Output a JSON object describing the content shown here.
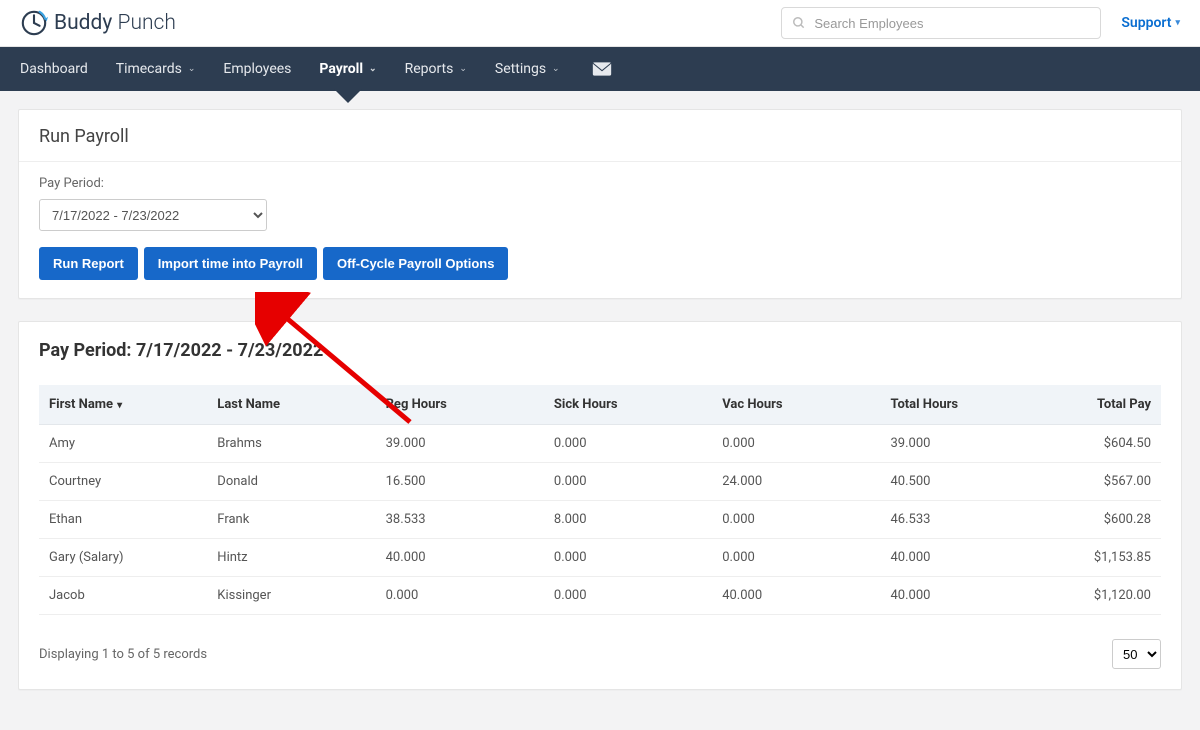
{
  "brand": {
    "name1": "Buddy",
    "name2": "Punch"
  },
  "search": {
    "placeholder": "Search Employees"
  },
  "support": {
    "label": "Support"
  },
  "nav": {
    "dashboard": "Dashboard",
    "timecards": "Timecards",
    "employees": "Employees",
    "payroll": "Payroll",
    "reports": "Reports",
    "settings": "Settings"
  },
  "runPayroll": {
    "title": "Run Payroll",
    "payPeriodLabel": "Pay Period:",
    "payPeriodValue": "7/17/2022 - 7/23/2022",
    "buttons": {
      "runReport": "Run Report",
      "importTime": "Import time into Payroll",
      "offCycle": "Off-Cycle Payroll Options"
    }
  },
  "periodSection": {
    "titlePrefix": "Pay Period: ",
    "titleRange": "7/17/2022 - 7/23/2022"
  },
  "table": {
    "headers": {
      "firstName": "First Name",
      "lastName": "Last Name",
      "regHours": "Reg Hours",
      "sickHours": "Sick Hours",
      "vacHours": "Vac Hours",
      "totalHours": "Total Hours",
      "totalPay": "Total Pay"
    },
    "rows": [
      {
        "firstName": "Amy",
        "lastName": "Brahms",
        "regHours": "39.000",
        "sickHours": "0.000",
        "vacHours": "0.000",
        "totalHours": "39.000",
        "totalPay": "$604.50"
      },
      {
        "firstName": "Courtney",
        "lastName": "Donald",
        "regHours": "16.500",
        "sickHours": "0.000",
        "vacHours": "24.000",
        "totalHours": "40.500",
        "totalPay": "$567.00"
      },
      {
        "firstName": "Ethan",
        "lastName": "Frank",
        "regHours": "38.533",
        "sickHours": "8.000",
        "vacHours": "0.000",
        "totalHours": "46.533",
        "totalPay": "$600.28"
      },
      {
        "firstName": "Gary (Salary)",
        "lastName": "Hintz",
        "regHours": "40.000",
        "sickHours": "0.000",
        "vacHours": "0.000",
        "totalHours": "40.000",
        "totalPay": "$1,153.85"
      },
      {
        "firstName": "Jacob",
        "lastName": "Kissinger",
        "regHours": "0.000",
        "sickHours": "0.000",
        "vacHours": "40.000",
        "totalHours": "40.000",
        "totalPay": "$1,120.00"
      }
    ]
  },
  "footer": {
    "displayText": "Displaying 1 to 5 of 5 records",
    "pageSize": "50"
  }
}
